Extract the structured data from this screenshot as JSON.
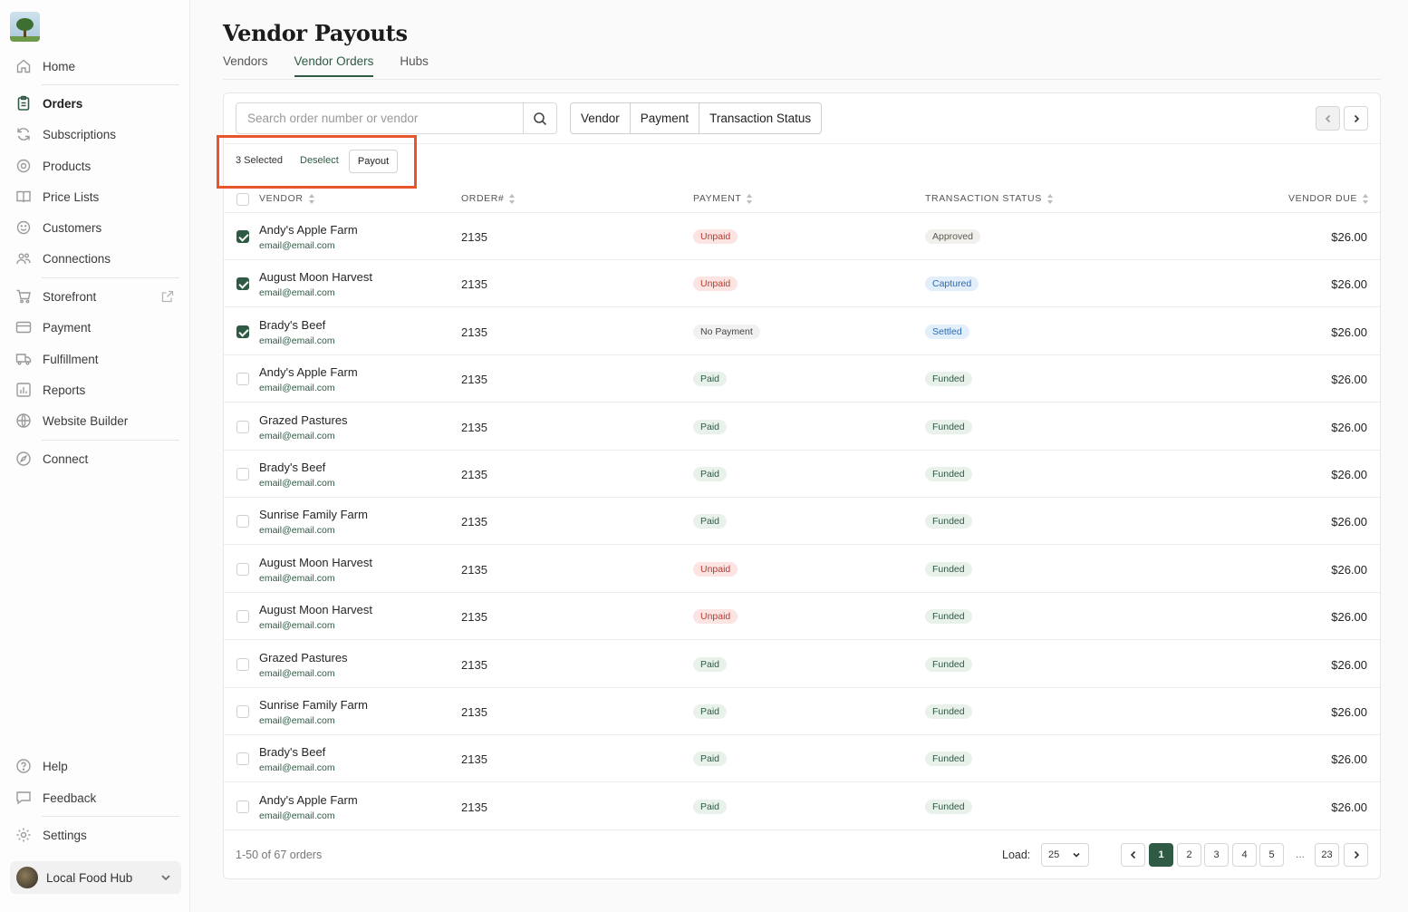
{
  "sidebar": {
    "items": [
      {
        "label": "Home"
      },
      {
        "label": "Orders"
      },
      {
        "label": "Subscriptions"
      },
      {
        "label": "Products"
      },
      {
        "label": "Price Lists"
      },
      {
        "label": "Customers"
      },
      {
        "label": "Connections"
      },
      {
        "label": "Storefront"
      },
      {
        "label": "Payment"
      },
      {
        "label": "Fulfillment"
      },
      {
        "label": "Reports"
      },
      {
        "label": "Website Builder"
      },
      {
        "label": "Connect"
      },
      {
        "label": "Help"
      },
      {
        "label": "Feedback"
      },
      {
        "label": "Settings"
      }
    ],
    "active": "Orders",
    "hub": {
      "label": "Local Food Hub"
    }
  },
  "header": {
    "title": "Vendor Payouts",
    "tabs": [
      {
        "label": "Vendors"
      },
      {
        "label": "Vendor Orders"
      },
      {
        "label": "Hubs"
      }
    ],
    "active_tab": "Vendor Orders"
  },
  "toolbar": {
    "search_placeholder": "Search order number or vendor",
    "filters": [
      {
        "label": "Vendor"
      },
      {
        "label": "Payment"
      },
      {
        "label": "Transaction Status"
      }
    ]
  },
  "selection": {
    "count_text": "3 Selected",
    "deselect_label": "Deselect",
    "payout_label": "Payout"
  },
  "table": {
    "headers": {
      "vendor": "VENDOR",
      "order": "ORDER#",
      "payment": "PAYMENT",
      "status": "TRANSACTION STATUS",
      "due": "VENDOR DUE"
    },
    "rows": [
      {
        "vendor": "Andy's Apple Farm",
        "email": "email@email.com",
        "order": "2135",
        "payment": "Unpaid",
        "status": "Approved",
        "due": "$26.00",
        "checked": true
      },
      {
        "vendor": "August Moon Harvest",
        "email": "email@email.com",
        "order": "2135",
        "payment": "Unpaid",
        "status": "Captured",
        "due": "$26.00",
        "checked": true
      },
      {
        "vendor": "Brady's Beef",
        "email": "email@email.com",
        "order": "2135",
        "payment": "No Payment",
        "status": "Settled",
        "due": "$26.00",
        "checked": true
      },
      {
        "vendor": "Andy's Apple Farm",
        "email": "email@email.com",
        "order": "2135",
        "payment": "Paid",
        "status": "Funded",
        "due": "$26.00",
        "checked": false
      },
      {
        "vendor": "Grazed Pastures",
        "email": "email@email.com",
        "order": "2135",
        "payment": "Paid",
        "status": "Funded",
        "due": "$26.00",
        "checked": false
      },
      {
        "vendor": "Brady's Beef",
        "email": "email@email.com",
        "order": "2135",
        "payment": "Paid",
        "status": "Funded",
        "due": "$26.00",
        "checked": false
      },
      {
        "vendor": "Sunrise Family Farm",
        "email": "email@email.com",
        "order": "2135",
        "payment": "Paid",
        "status": "Funded",
        "due": "$26.00",
        "checked": false
      },
      {
        "vendor": "August Moon Harvest",
        "email": "email@email.com",
        "order": "2135",
        "payment": "Unpaid",
        "status": "Funded",
        "due": "$26.00",
        "checked": false
      },
      {
        "vendor": "August Moon Harvest",
        "email": "email@email.com",
        "order": "2135",
        "payment": "Unpaid",
        "status": "Funded",
        "due": "$26.00",
        "checked": false
      },
      {
        "vendor": "Grazed Pastures",
        "email": "email@email.com",
        "order": "2135",
        "payment": "Paid",
        "status": "Funded",
        "due": "$26.00",
        "checked": false
      },
      {
        "vendor": "Sunrise Family Farm",
        "email": "email@email.com",
        "order": "2135",
        "payment": "Paid",
        "status": "Funded",
        "due": "$26.00",
        "checked": false
      },
      {
        "vendor": "Brady's Beef",
        "email": "email@email.com",
        "order": "2135",
        "payment": "Paid",
        "status": "Funded",
        "due": "$26.00",
        "checked": false
      },
      {
        "vendor": "Andy's Apple Farm",
        "email": "email@email.com",
        "order": "2135",
        "payment": "Paid",
        "status": "Funded",
        "due": "$26.00",
        "checked": false
      }
    ]
  },
  "footer": {
    "count_text": "1-50 of 67 orders",
    "load_label": "Load:",
    "load_value": "25",
    "pages": [
      "1",
      "2",
      "3",
      "4",
      "5"
    ],
    "ellipsis": "...",
    "last_page": "23",
    "current_page": "1"
  },
  "badge_styles": {
    "Unpaid": {
      "bg": "#fbe4e2",
      "fg": "#c0392b"
    },
    "No Payment": {
      "bg": "#f1f1f1",
      "fg": "#444444"
    },
    "Paid": {
      "bg": "#e8f2ea",
      "fg": "#2f5a44"
    },
    "Approved": {
      "bg": "#f1f0ec",
      "fg": "#5c5a4e"
    },
    "Captured": {
      "bg": "#e3eefb",
      "fg": "#2b6cb0"
    },
    "Settled": {
      "bg": "#e3eefb",
      "fg": "#2b6cb0"
    },
    "Funded": {
      "bg": "#e8f2ea",
      "fg": "#2f5a44"
    }
  },
  "colors": {
    "accent": "#2f5a44",
    "highlight_box": "#e8552b"
  }
}
